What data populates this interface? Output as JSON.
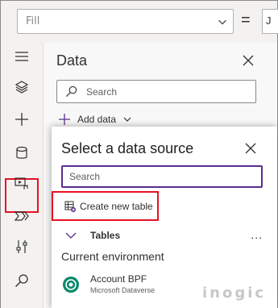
{
  "formula_bar": {
    "property": "Fill",
    "equals": "=",
    "formula_fragment": "J"
  },
  "rail": {
    "items": [
      {
        "name": "hamburger-icon",
        "label": "Menu"
      },
      {
        "name": "layers-icon",
        "label": "Tree view"
      },
      {
        "name": "plus-icon",
        "label": "Insert"
      },
      {
        "name": "database-icon",
        "label": "Data"
      },
      {
        "name": "media-icon",
        "label": "Media"
      },
      {
        "name": "power-automate-icon",
        "label": "Power Automate"
      },
      {
        "name": "tools-icon",
        "label": "Advanced tools"
      },
      {
        "name": "search-icon",
        "label": "Search"
      }
    ],
    "highlight_color": "#e81123"
  },
  "data_panel": {
    "title": "Data",
    "search_placeholder": "Search",
    "add_data_label": "Add data"
  },
  "select_source": {
    "title": "Select a data source",
    "search_placeholder": "Search",
    "create_table_label": "Create new table",
    "tables_label": "Tables",
    "more": "...",
    "section_label": "Current environment",
    "items": [
      {
        "name": "Account BPF",
        "source": "Microsoft Dataverse"
      }
    ],
    "accent_color": "#5b2d8e"
  },
  "watermark": "inogic"
}
